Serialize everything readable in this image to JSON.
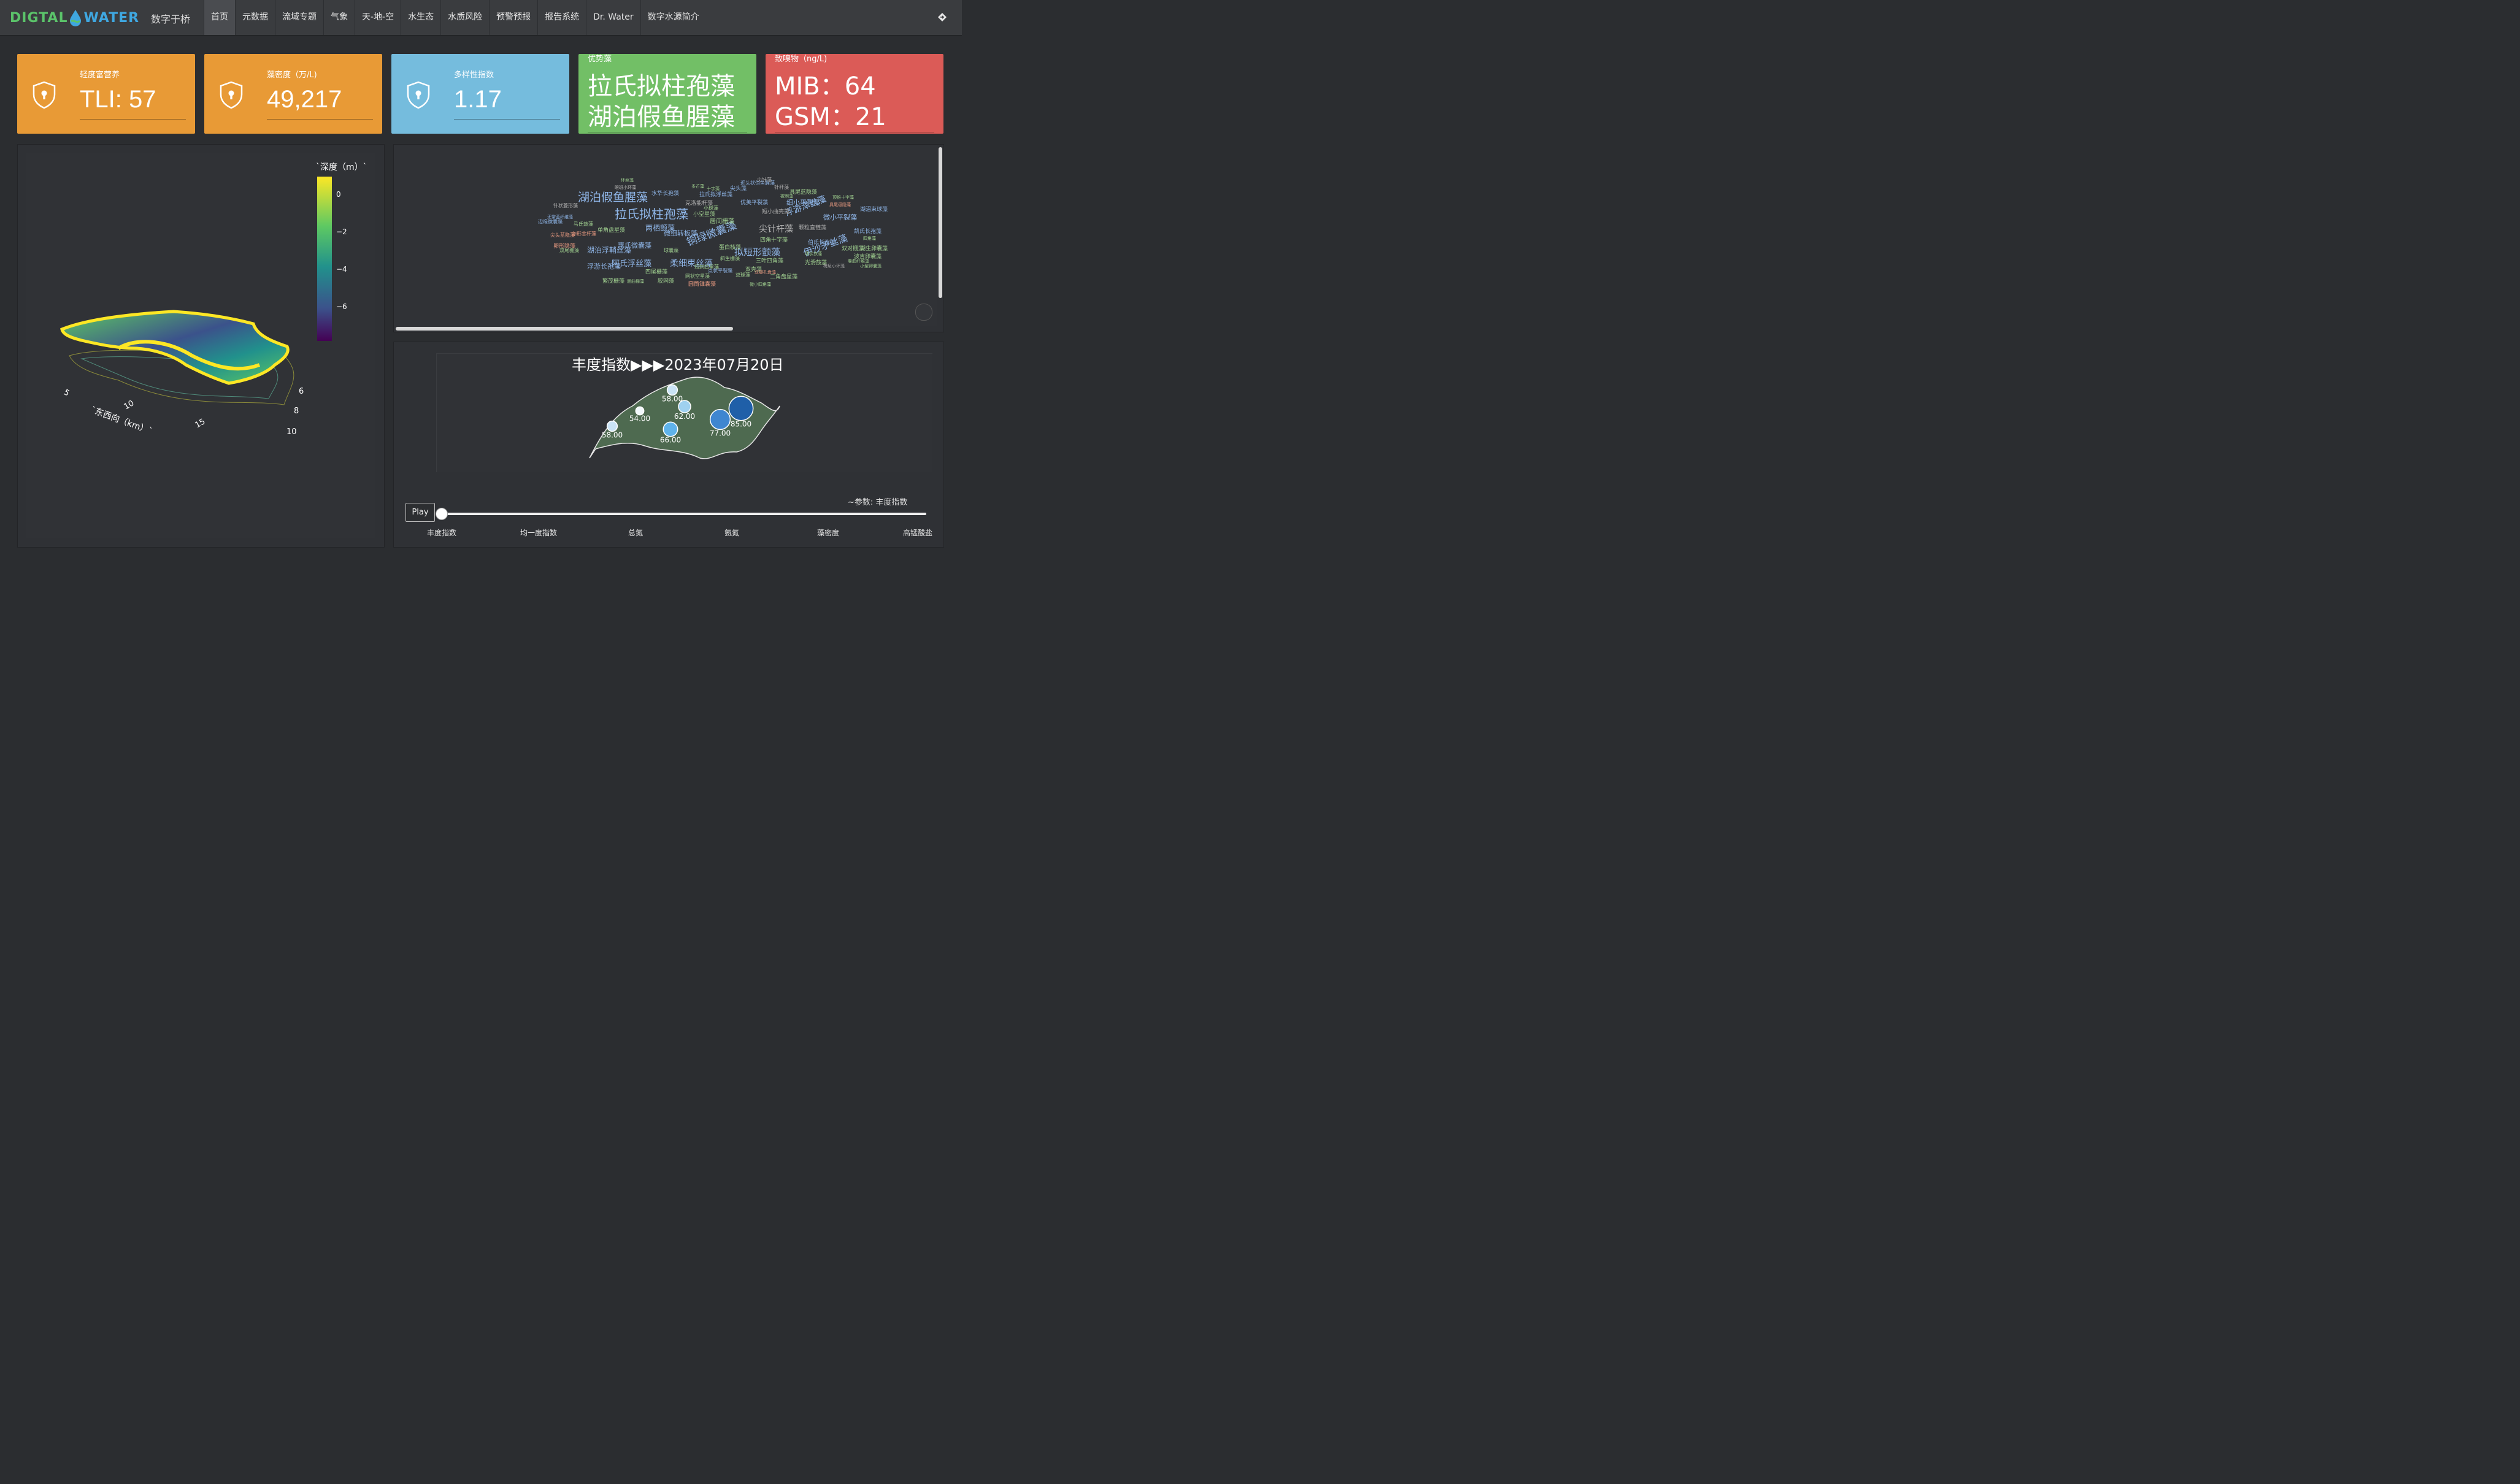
{
  "navbar": {
    "logo_left": "DIGTAL",
    "logo_right": "WATER",
    "brand_cn": "数字于桥",
    "items": [
      {
        "label": "首页",
        "active": true
      },
      {
        "label": "元数据"
      },
      {
        "label": "流域专题"
      },
      {
        "label": "气象"
      },
      {
        "label": "天-地-空"
      },
      {
        "label": "水生态"
      },
      {
        "label": "水质风险"
      },
      {
        "label": "预警预报"
      },
      {
        "label": "报告系统"
      },
      {
        "label": "Dr. Water"
      },
      {
        "label": "数字水源简介"
      }
    ],
    "right_icon": "sign-in-icon"
  },
  "cards": {
    "tli": {
      "label": "轻度富营养",
      "value": "TLI:  57",
      "color": "#e89a36"
    },
    "algae_density": {
      "label": "藻密度（万/L)",
      "value": "49,217",
      "color": "#e89a36"
    },
    "diversity": {
      "label": "多样性指数",
      "value": "1.17",
      "color": "#75bcdd"
    },
    "dominant": {
      "label": "优势藻",
      "line1": "拉氏拟柱孢藻",
      "line2": "湖泊假鱼腥藻",
      "color": "#72bf66"
    },
    "odor": {
      "label": "致嗅物（ng/L)",
      "line1": "MIB：64",
      "line2": "GSM：21",
      "color": "#db5b57"
    }
  },
  "depth_plot": {
    "colorbar_title": "`深度（m）`",
    "colorbar_ticks": [
      "0",
      "−2",
      "−4",
      "−6"
    ],
    "x_axis_title": "`东西向（km）`",
    "x_ticks": [
      "5",
      "10",
      "15"
    ],
    "y_ticks": [
      "6",
      "8",
      "10"
    ],
    "colorscale": [
      "#fde725",
      "#5ec962",
      "#21918c",
      "#3b528b",
      "#440154"
    ]
  },
  "word_cloud": {
    "words": [
      {
        "text": "湖泊假鱼腥藻",
        "size": 19,
        "color": "#8fb6e8"
      },
      {
        "text": "拉氏拟柱孢藻",
        "size": 20,
        "color": "#8fb6e8"
      },
      {
        "text": "铜绿微囊藻",
        "size": 17,
        "color": "#8fb6e8"
      },
      {
        "text": "尖针杆藻",
        "size": 14,
        "color": "#b0b0b0"
      },
      {
        "text": "拟短形颤藻",
        "size": 15,
        "color": "#8fb6e8"
      },
      {
        "text": "伊沙矛丝藻",
        "size": 15,
        "color": "#8fb6e8"
      },
      {
        "text": "浮游泽丝藻",
        "size": 14,
        "color": "#8fb6e8"
      },
      {
        "text": "柔细束丝藻",
        "size": 14,
        "color": "#8fb6e8"
      },
      {
        "text": "阿氏浮丝藻",
        "size": 13,
        "color": "#8fb6e8"
      },
      {
        "text": "湖泊浮鞘丝藻",
        "size": 12,
        "color": "#8fb6e8"
      },
      {
        "text": "两栖颤藻",
        "size": 12,
        "color": "#8fb6e8"
      },
      {
        "text": "惠氏微囊藻",
        "size": 11,
        "color": "#8fb6e8"
      },
      {
        "text": "浮游长孢藻",
        "size": 11,
        "color": "#8fb6e8"
      },
      {
        "text": "细小平裂藻",
        "size": 11,
        "color": "#8fb6e8"
      },
      {
        "text": "微小平裂藻",
        "size": 11,
        "color": "#8fb6e8"
      },
      {
        "text": "微细转板藻",
        "size": 11,
        "color": "#8fb6e8"
      },
      {
        "text": "居间栅藻",
        "size": 10,
        "color": "#a0d090"
      },
      {
        "text": "水华长孢藻",
        "size": 9,
        "color": "#8fb6e8"
      },
      {
        "text": "克洛能杆藻",
        "size": 9,
        "color": "#b0b0b0"
      },
      {
        "text": "优美平裂藻",
        "size": 9,
        "color": "#8fb6e8"
      },
      {
        "text": "具尾蓝隐藻",
        "size": 9,
        "color": "#a0d090"
      },
      {
        "text": "拉氏拟浮丝藻",
        "size": 9,
        "color": "#8fb6e8"
      },
      {
        "text": "小空星藻",
        "size": 9,
        "color": "#a0d090"
      },
      {
        "text": "短小曲壳藻",
        "size": 9,
        "color": "#b0b0b0"
      },
      {
        "text": "单角盘星藻",
        "size": 9,
        "color": "#a0d090"
      },
      {
        "text": "蛋白核藻",
        "size": 9,
        "color": "#a0d090"
      },
      {
        "text": "四角十字藻",
        "size": 9,
        "color": "#a0d090"
      },
      {
        "text": "三叶四角藻",
        "size": 9,
        "color": "#a0d090"
      },
      {
        "text": "伯氏长孢藻",
        "size": 9,
        "color": "#8fb6e8"
      },
      {
        "text": "凯氏长孢藻",
        "size": 9,
        "color": "#8fb6e8"
      },
      {
        "text": "颗粒直链藻",
        "size": 9,
        "color": "#b0b0b0"
      },
      {
        "text": "四尾栅藻",
        "size": 9,
        "color": "#a0d090"
      },
      {
        "text": "光滑鼓藻",
        "size": 9,
        "color": "#a0d090"
      },
      {
        "text": "胶网藻",
        "size": 9,
        "color": "#a0d090"
      },
      {
        "text": "繁茂栅藻",
        "size": 9,
        "color": "#a0d090"
      },
      {
        "text": "二角盘星藻",
        "size": 9,
        "color": "#a0d090"
      },
      {
        "text": "湖生卵囊藻",
        "size": 9,
        "color": "#a0d090"
      },
      {
        "text": "波吉卵囊藻",
        "size": 9,
        "color": "#a0d090"
      },
      {
        "text": "湖沼束球藻",
        "size": 9,
        "color": "#8fb6e8"
      },
      {
        "text": "双对栅藻",
        "size": 9,
        "color": "#a0d090"
      },
      {
        "text": "尖头藻",
        "size": 9,
        "color": "#8fb6e8"
      },
      {
        "text": "圆筒锥囊藻",
        "size": 9,
        "color": "#e89a80"
      },
      {
        "text": "卵形隐藻",
        "size": 9,
        "color": "#e89a80"
      },
      {
        "text": "双壳藻",
        "size": 9,
        "color": "#a0d090"
      },
      {
        "text": "近头状伪鱼腥藻",
        "size": 8,
        "color": "#8fb6e8"
      },
      {
        "text": "针杆藻",
        "size": 8,
        "color": "#b0b0b0"
      },
      {
        "text": "尖针藻",
        "size": 8,
        "color": "#b0b0b0"
      },
      {
        "text": "小球藻",
        "size": 8,
        "color": "#a0d090"
      },
      {
        "text": "球囊藻",
        "size": 8,
        "color": "#a0d090"
      },
      {
        "text": "马氏鼓藻",
        "size": 8,
        "color": "#a0d090"
      },
      {
        "text": "双球藻",
        "size": 8,
        "color": "#a0d090"
      },
      {
        "text": "斜生栅藻",
        "size": 8,
        "color": "#a0d090"
      },
      {
        "text": "点状平裂藻",
        "size": 8,
        "color": "#8fb6e8"
      },
      {
        "text": "网状空星藻",
        "size": 8,
        "color": "#a0d090"
      },
      {
        "text": "短刺四星藻",
        "size": 8,
        "color": "#a0d090"
      },
      {
        "text": "双尾栅藻",
        "size": 8,
        "color": "#a0d090"
      },
      {
        "text": "卵形金杆藻",
        "size": 8,
        "color": "#e89a80"
      },
      {
        "text": "尖头蓝隐藻",
        "size": 8,
        "color": "#e89a80"
      },
      {
        "text": "边缘微囊藻",
        "size": 8,
        "color": "#8fb6e8"
      },
      {
        "text": "针状菱形藻",
        "size": 8,
        "color": "#b0b0b0"
      },
      {
        "text": "无常蓝纤维藻",
        "size": 7,
        "color": "#8fb6e8"
      },
      {
        "text": "顶锥十字藻",
        "size": 7,
        "color": "#a0d090"
      },
      {
        "text": "双瓣孔盘藻",
        "size": 7,
        "color": "#e89a80"
      },
      {
        "text": "微小四角藻",
        "size": 7,
        "color": "#a0d090"
      },
      {
        "text": "卷曲纤维藻",
        "size": 7,
        "color": "#a0d090"
      },
      {
        "text": "四角藻",
        "size": 7,
        "color": "#a0d090"
      },
      {
        "text": "小型卵囊藻",
        "size": 7,
        "color": "#a0d090"
      },
      {
        "text": "被刺藻",
        "size": 7,
        "color": "#a0d090"
      },
      {
        "text": "十字藻",
        "size": 7,
        "color": "#a0d090"
      },
      {
        "text": "多芒藻",
        "size": 7,
        "color": "#a0d090"
      },
      {
        "text": "眼斑小环藻",
        "size": 7,
        "color": "#b0b0b0"
      },
      {
        "text": "梅尼小环藻",
        "size": 7,
        "color": "#b0b0b0"
      },
      {
        "text": "球状衣藻",
        "size": 7,
        "color": "#a0d090"
      },
      {
        "text": "屈曲栅藻",
        "size": 7,
        "color": "#a0d090"
      },
      {
        "text": "具尾逗隐藻",
        "size": 7,
        "color": "#e89a80"
      },
      {
        "text": "环丝藻",
        "size": 7,
        "color": "#a0d090"
      }
    ]
  },
  "abundance_map": {
    "title": "丰度指数▶▶▶2023年07月20日",
    "land_color": "#4e6a50",
    "points": [
      {
        "value": 58.0,
        "label": "58.00",
        "color": "#c9e3f5"
      },
      {
        "value": 54.0,
        "label": "54.00",
        "color": "#f2f8fc"
      },
      {
        "value": 62.0,
        "label": "62.00",
        "color": "#9fd1f0"
      },
      {
        "value": 58.0,
        "label": "58.00",
        "color": "#c9e3f5"
      },
      {
        "value": 66.0,
        "label": "66.00",
        "color": "#5fb3ea"
      },
      {
        "value": 77.0,
        "label": "77.00",
        "color": "#3f86d0"
      },
      {
        "value": 85.0,
        "label": "85.00",
        "color": "#1f5fa8"
      }
    ]
  },
  "slider": {
    "play_label": "Play",
    "current_label": "~参数: 丰度指数",
    "steps": [
      "丰度指数",
      "均一度指数",
      "总氮",
      "氨氮",
      "藻密度",
      "高锰酸盐"
    ]
  }
}
